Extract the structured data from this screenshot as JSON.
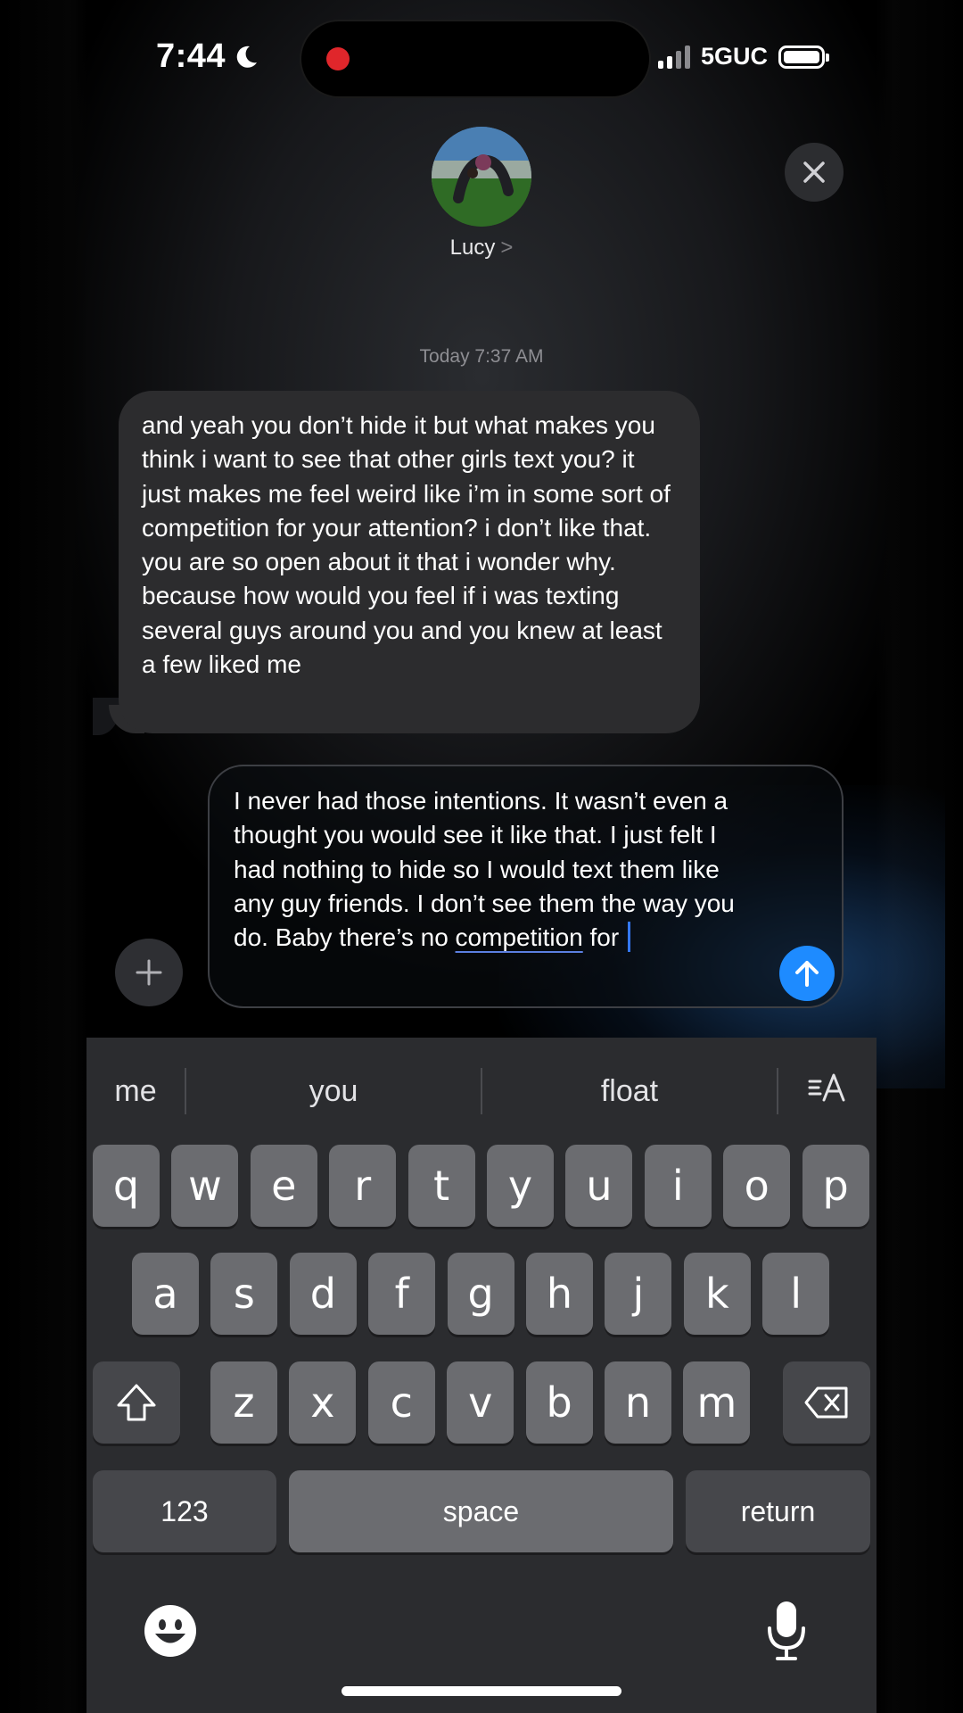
{
  "status_bar": {
    "time": "7:44",
    "network": "5GUC"
  },
  "contact": {
    "name": "Lucy",
    "chevron": ">"
  },
  "thread": {
    "timestamp": "Today 7:37 AM",
    "received_message": "and yeah you don’t hide it but what makes you think i want to see that other girls text you? it just makes me feel weird like i’m in some sort of competition for your attention? i don’t like that. you are so open about it that i wonder why. because how would you feel if i was texting several guys around you and you knew at least a few liked me"
  },
  "compose": {
    "text_before": "I never had those intentions. It wasn’t even a thought you would see it like that. I just felt I had nothing to hide so I would text them like any guy friends. I don’t see them the way you do. Baby there’s no ",
    "text_underlined": "competition",
    "text_after": " for "
  },
  "keyboard": {
    "suggestions": [
      "me",
      "you",
      "float"
    ],
    "row1": [
      "q",
      "w",
      "e",
      "r",
      "t",
      "y",
      "u",
      "i",
      "o",
      "p"
    ],
    "row2": [
      "a",
      "s",
      "d",
      "f",
      "g",
      "h",
      "j",
      "k",
      "l"
    ],
    "row3": [
      "z",
      "x",
      "c",
      "v",
      "b",
      "n",
      "m"
    ],
    "numbers_label": "123",
    "space_label": "space",
    "return_label": "return"
  },
  "colors": {
    "send_button": "#1e8bff",
    "received_bubble": "#2c2c2e",
    "record_indicator": "#e0262b"
  }
}
